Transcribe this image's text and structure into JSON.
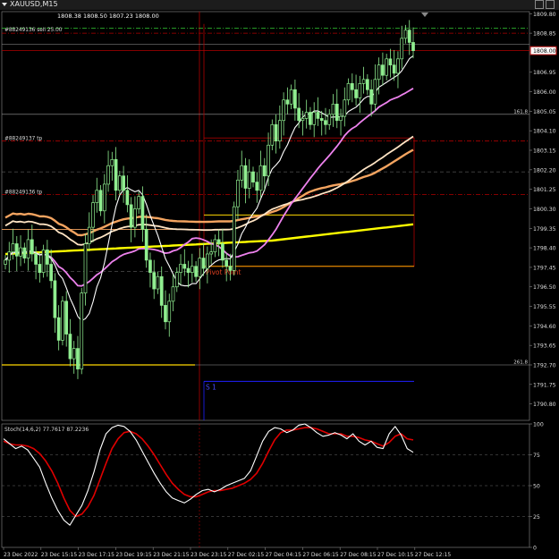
{
  "window": {
    "title": "XAUUSD,M15",
    "ohlc": "1808.38 1808.50 1807.23 1808.00",
    "menu_icon": "dropdown-triangle-icon"
  },
  "colors": {
    "background": "#000000",
    "grid": "#8a8a8a",
    "candle": "#90ee90",
    "ma_fast": "#ffffff",
    "ma_violet": "#ee82ee",
    "ma_orange": "#f4a460",
    "ma_cream": "#ffe4c4",
    "ma_yellow": "#ffff00",
    "stoch_main": "#ffffff",
    "stoch_signal": "#e00000",
    "level_red": "#b00000",
    "level_gold": "#ffd700",
    "price_highlight": "#b00000"
  },
  "order_labels": [
    {
      "text": "#88249136 sell 25.00",
      "price": 1808.9
    },
    {
      "text": "#88249137 tp",
      "price": 1803.6
    },
    {
      "text": "#88249136 tp",
      "price": 1801.0
    }
  ],
  "levels": [
    {
      "label": "Pivot Point",
      "price": 1797.5,
      "color": "#ffa500"
    },
    {
      "label": "S 1",
      "price": 1791.9,
      "color": "#0000ff"
    }
  ],
  "fib_labels": [
    {
      "text": "161.8",
      "price": 1804.9
    },
    {
      "text": "261.8",
      "price": 1792.7
    }
  ],
  "stoch": {
    "label": "Stoch(14,6,2) 77.7617 87.2236",
    "ticks": [
      "100",
      "75",
      "50",
      "25",
      "0"
    ]
  },
  "chart_data": {
    "type": "line",
    "title": "XAUUSD,M15",
    "ylim": [
      1790.0,
      1809.9
    ],
    "ticks_y": [
      "1809.80",
      "1808.85",
      "1807.90",
      "1806.95",
      "1806.00",
      "1805.05",
      "1804.10",
      "1803.15",
      "1802.20",
      "1801.25",
      "1800.30",
      "1799.35",
      "1798.40",
      "1797.45",
      "1796.50",
      "1795.55",
      "1794.60",
      "1793.65",
      "1792.70",
      "1791.75",
      "1790.80"
    ],
    "current_price": "1808.00",
    "x_labels": [
      "23 Dec 2022",
      "23 Dec 15:15",
      "23 Dec 17:15",
      "23 Dec 19:15",
      "23 Dec 21:15",
      "23 Dec 23:15",
      "27 Dec 02:15",
      "27 Dec 04:15",
      "27 Dec 06:15",
      "27 Dec 08:15",
      "27 Dec 10:15",
      "27 Dec 12:15"
    ],
    "close": [
      1797.8,
      1798.2,
      1798.6,
      1798.0,
      1798.4,
      1797.9,
      1798.8,
      1798.1,
      1797.6,
      1797.2,
      1798.3,
      1797.6,
      1796.8,
      1795.0,
      1793.9,
      1795.8,
      1794.2,
      1793.0,
      1793.5,
      1792.5,
      1796.2,
      1798.6,
      1799.4,
      1800.6,
      1801.2,
      1800.2,
      1801.5,
      1802.4,
      1802.7,
      1801.2,
      1801.9,
      1801.2,
      1800.5,
      1799.4,
      1800.3,
      1800.9,
      1799.3,
      1797.8,
      1797.2,
      1796.4,
      1797.0,
      1795.6,
      1794.8,
      1795.8,
      1796.5,
      1797.2,
      1797.6,
      1797.4,
      1797.2,
      1797.5,
      1797.0,
      1797.9,
      1797.4,
      1798.1,
      1798.2,
      1798.8,
      1798.6,
      1797.8,
      1797.5,
      1797.3,
      1800.4,
      1801.7,
      1802.4,
      1801.3,
      1802.1,
      1801.6,
      1801.2,
      1802.4,
      1801.9,
      1803.4,
      1804.4,
      1803.6,
      1804.6,
      1805.6,
      1805.4,
      1806.1,
      1805.2,
      1804.6,
      1804.7,
      1805.0,
      1804.4,
      1805.0,
      1804.7,
      1804.6,
      1804.4,
      1804.9,
      1805.4,
      1804.6,
      1804.8,
      1805.6,
      1806.4,
      1806.1,
      1805.7,
      1806.4,
      1806.6,
      1806.1,
      1805.4,
      1806.6,
      1807.3,
      1806.8,
      1807.6,
      1807.3,
      1806.9,
      1807.6,
      1808.6,
      1809.0,
      1808.4,
      1808.0
    ],
    "stoch_k": [
      88,
      84,
      80,
      82,
      79,
      72,
      65,
      52,
      40,
      30,
      22,
      18,
      26,
      34,
      46,
      61,
      79,
      92,
      97,
      99,
      98,
      94,
      87,
      78,
      69,
      60,
      52,
      45,
      40,
      38,
      36,
      39,
      43,
      46,
      47,
      45,
      47,
      50,
      52,
      54,
      56,
      62,
      74,
      86,
      94,
      97,
      96,
      93,
      95,
      99,
      100,
      97,
      93,
      90,
      91,
      93,
      91,
      88,
      92,
      86,
      83,
      86,
      81,
      80,
      92,
      98,
      91,
      80,
      77
    ],
    "stoch_d": [
      86,
      84,
      83,
      83,
      82,
      80,
      76,
      70,
      62,
      52,
      40,
      30,
      25,
      27,
      33,
      42,
      55,
      68,
      80,
      88,
      93,
      94,
      92,
      88,
      82,
      75,
      67,
      59,
      52,
      47,
      43,
      41,
      41,
      43,
      45,
      46,
      46,
      47,
      48,
      50,
      52,
      55,
      60,
      68,
      78,
      87,
      93,
      95,
      95,
      96,
      97,
      97,
      96,
      94,
      92,
      92,
      92,
      90,
      90,
      89,
      87,
      86,
      84,
      82,
      85,
      90,
      92,
      88,
      87
    ]
  }
}
